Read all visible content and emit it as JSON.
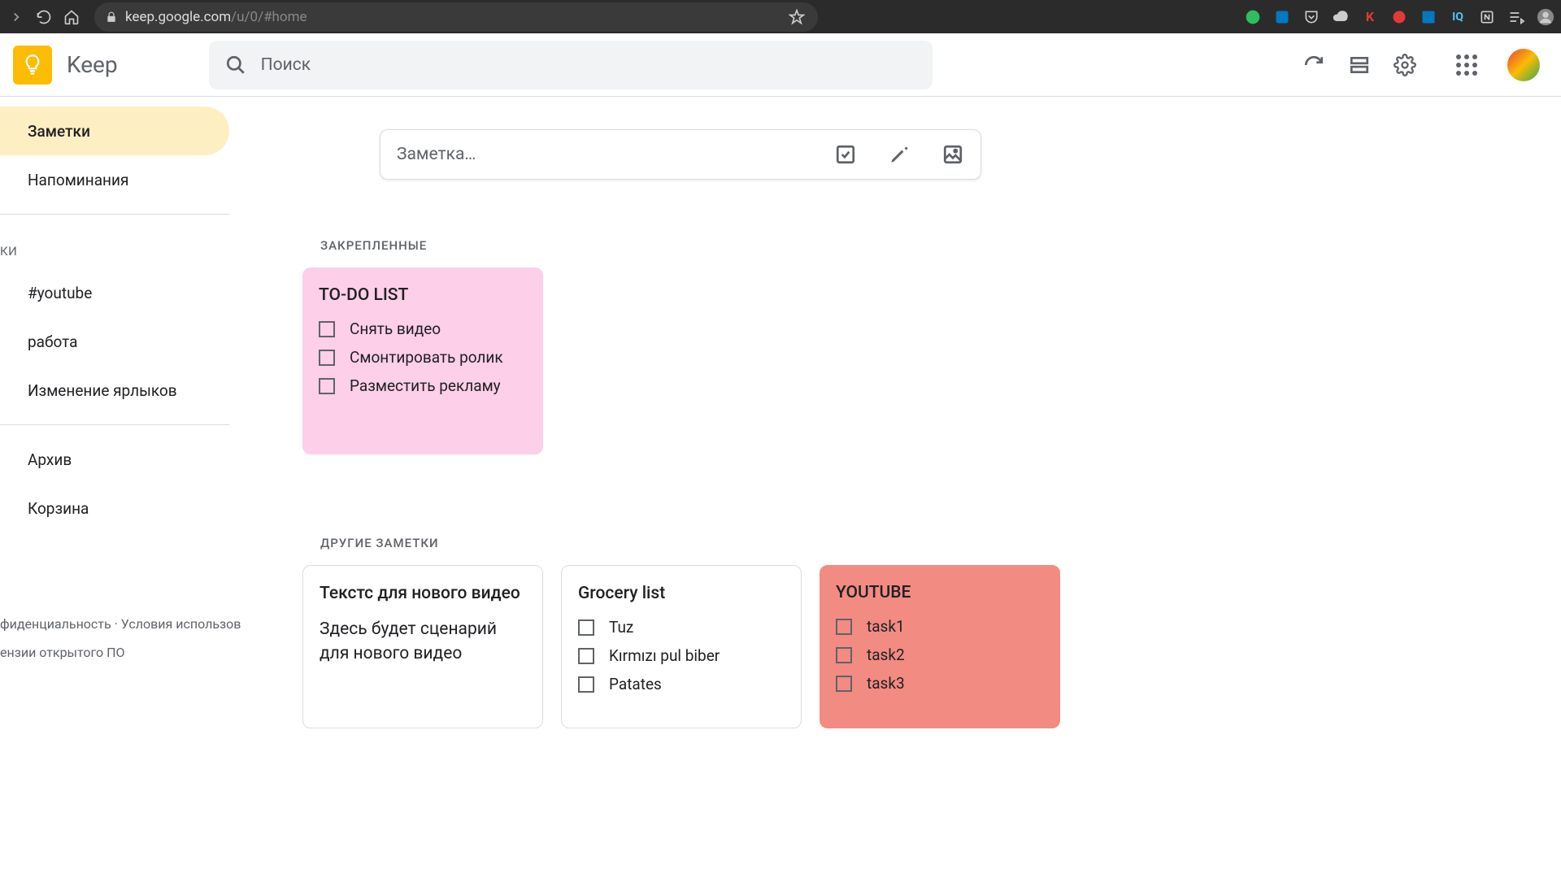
{
  "browser": {
    "url_host": "keep.google.com",
    "url_path": "/u/0/#home"
  },
  "header": {
    "app_name": "Keep",
    "search_placeholder": "Поиск"
  },
  "sidebar": {
    "items": [
      {
        "label": "Заметки",
        "active": true
      },
      {
        "label": "Напоминания",
        "active": false
      }
    ],
    "labels_header": "КИ",
    "labels": [
      {
        "label": "#youtube"
      },
      {
        "label": "работа"
      },
      {
        "label": "Изменение ярлыков"
      }
    ],
    "bottom": [
      {
        "label": "Архив"
      },
      {
        "label": "Корзина"
      }
    ],
    "footer_line1": "фиденциальность  ·  Условия использов",
    "footer_line2": "ензии открытого ПО"
  },
  "note_create_placeholder": "Заметка…",
  "sections": {
    "pinned": "ЗАКРЕПЛЕННЫЕ",
    "others": "ДРУГИЕ ЗАМЕТКИ"
  },
  "pinned_notes": [
    {
      "title": "TO-DO LIST",
      "color": "pink",
      "items": [
        "Снять видео",
        "Смонтировать ролик",
        "Разместить рекламу"
      ]
    }
  ],
  "other_notes": [
    {
      "title": "Текстс для нового видео",
      "body": "Здесь будет сценарий для нового видео",
      "type": "text"
    },
    {
      "title": "Grocery list",
      "type": "checklist",
      "items": [
        "Tuz",
        "Kırmızı pul biber",
        "Patates"
      ]
    },
    {
      "title": "YOUTUBE",
      "type": "checklist",
      "color": "coral",
      "items": [
        "task1",
        "task2",
        "task3"
      ]
    }
  ]
}
